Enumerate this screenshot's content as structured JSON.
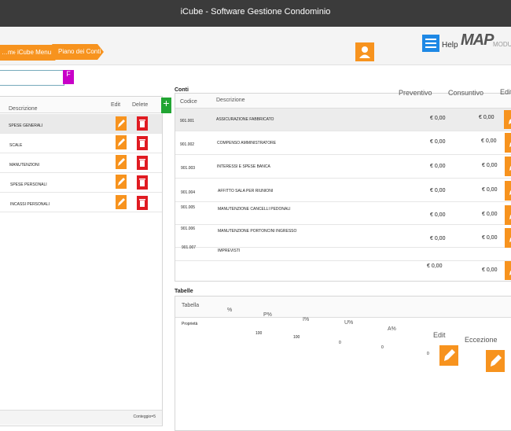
{
  "app": {
    "title": "iCube - Software Gestione Condominio"
  },
  "header": {
    "help_label": "Help",
    "brand": "MAP",
    "brand_suffix": "MODU"
  },
  "breadcrumb": [
    "…me",
    "iCube Menu",
    "Piano dei Conti"
  ],
  "search": {
    "value": "",
    "button_label": "F"
  },
  "left_table": {
    "columns": [
      "Descrizione",
      "Edit",
      "Delete"
    ],
    "rows": [
      "SPESE GENERALI",
      "SCALE",
      "MANUTENZIONI",
      "SPESE PERSONALI",
      "INCASSI PERSONALI"
    ],
    "footer": "Conteggio=5"
  },
  "conti": {
    "title": "Conti",
    "columns": [
      "Codice",
      "Descrizione",
      "Preventivo",
      "Consuntivo",
      "Edit"
    ],
    "rows": [
      {
        "codice": "901.001",
        "descrizione": "ASSICURAZIONE FABBRICATO",
        "preventivo": "€ 0,00",
        "consuntivo": "€ 0,00"
      },
      {
        "codice": "901.002",
        "descrizione": "COMPENSO AMMINISTRATORE",
        "preventivo": "€ 0,00",
        "consuntivo": "€ 0,00"
      },
      {
        "codice": "901.003",
        "descrizione": "INTERESSI E SPESE BANCA",
        "preventivo": "€ 0,00",
        "consuntivo": "€ 0,00"
      },
      {
        "codice": "901.004",
        "descrizione": "AFFITTO SALA PER RIUNIONI",
        "preventivo": "€ 0,00",
        "consuntivo": "€ 0,00"
      },
      {
        "codice": "901.005",
        "descrizione": "MANUTENZIONE CANCELLI PEDONALI",
        "preventivo": "€ 0,00",
        "consuntivo": "€ 0,00"
      },
      {
        "codice": "901.006",
        "descrizione": "MANUTENZIONE PORTONCINI INGRESSO",
        "preventivo": "€ 0,00",
        "consuntivo": "€ 0,00"
      },
      {
        "codice": "901.007",
        "descrizione": "IMPREVISTI",
        "preventivo": "€ 0,00",
        "consuntivo": "€ 0,00"
      }
    ],
    "totals": {
      "preventivo": "€ 0,00",
      "consuntivo": "€ 0,00"
    }
  },
  "tabelle": {
    "title": "Tabelle",
    "columns": [
      "Tabella",
      "%",
      "P%",
      "I%",
      "U%",
      "A%",
      "Edit",
      "Eccezione"
    ],
    "row": {
      "tabella": "Proprietà",
      "pct": "100",
      "p": "100",
      "i": "0",
      "u": "0",
      "a": "0"
    }
  },
  "colors": {
    "accent": "#f7931e",
    "danger": "#e01b22",
    "add": "#22a533",
    "menu": "#1e88e5",
    "search": "#c800c8"
  }
}
